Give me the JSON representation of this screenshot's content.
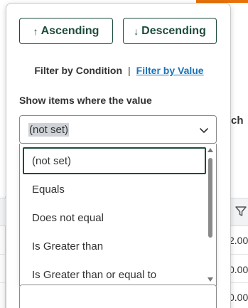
{
  "sort": {
    "ascending_label": "Ascending",
    "descending_label": "Descending"
  },
  "filter_tabs": {
    "by_condition": "Filter by Condition",
    "separator": "|",
    "by_value": "Filter by Value"
  },
  "condition": {
    "label": "Show items where the value",
    "selected": "(not set)",
    "options": [
      "(not set)",
      "Equals",
      "Does not equal",
      "Is Greater than",
      "Is Greater than or equal to"
    ]
  },
  "background": {
    "partial_header_text": "ch",
    "partial_values": [
      "2.00",
      "0.00",
      "0.00"
    ]
  },
  "colors": {
    "accent": "#1e4d3a",
    "link": "#1a73b8",
    "brand_orange": "#e8710a"
  }
}
